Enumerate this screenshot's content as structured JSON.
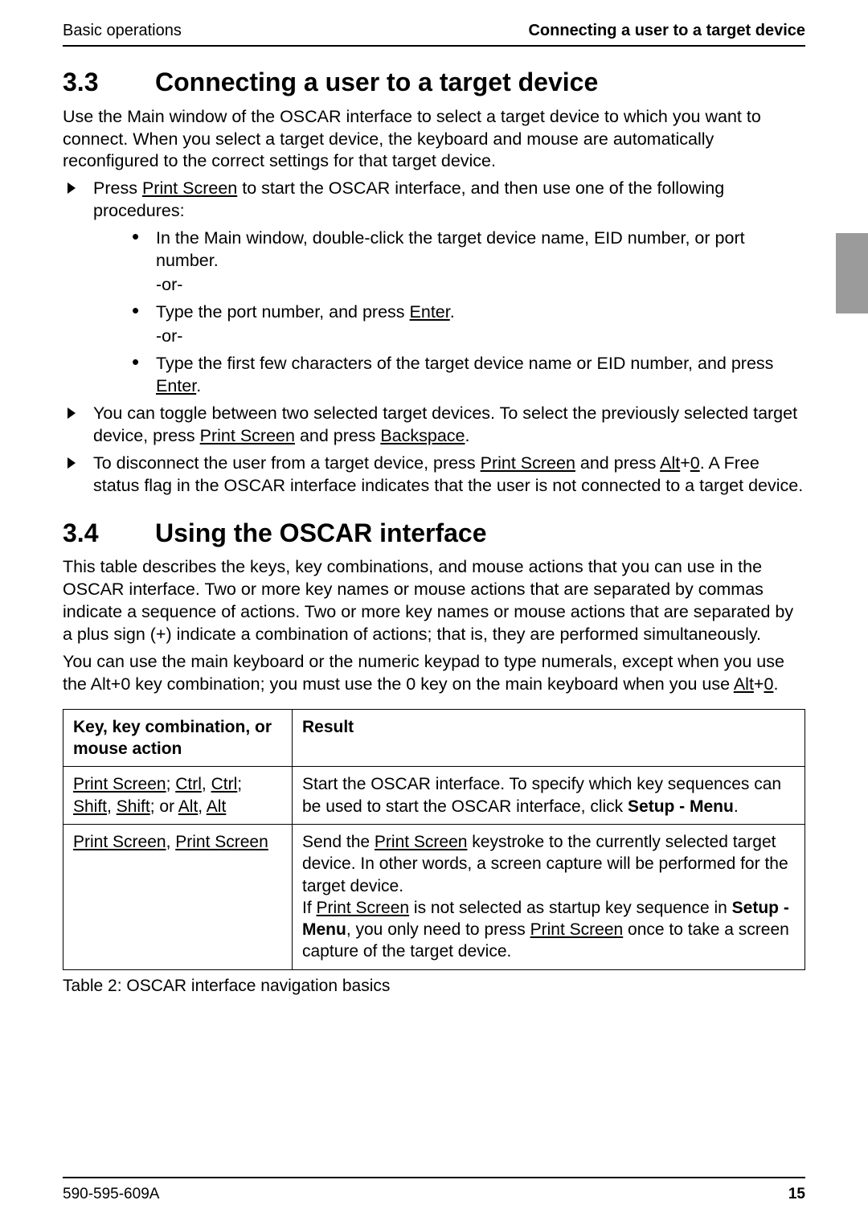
{
  "header": {
    "left": "Basic operations",
    "right": "Connecting a user to a target device"
  },
  "section33": {
    "number": "3.3",
    "title": "Connecting a user to a target device",
    "intro": "Use the Main window of the OSCAR interface to select a target device to which you want to connect. When you select a target device, the keyboard and mouse are automatically reconfigured to the correct settings for that target device.",
    "b1_pre": "Press ",
    "b1_u1": "Print Screen",
    "b1_post": " to start the OSCAR interface, and then use one of the following procedures:",
    "d1": "In the Main window, double-click the target device name, EID number, or port number.",
    "or": "-or-",
    "d2_pre": "Type the port number, and press ",
    "d2_u": "Enter",
    "d2_post": ".",
    "d3_pre": "Type the first few characters of the target device name or EID number, and press ",
    "d3_u": "Enter",
    "d3_post": ".",
    "b2_pre": "You can toggle between two selected target devices. To select the previously selected target device, press ",
    "b2_u1": "Print Screen",
    "b2_mid": " and press ",
    "b2_u2": "Backspace",
    "b2_post": ".",
    "b3_pre": "To disconnect the user from a target device, press ",
    "b3_u1": "Print Screen",
    "b3_mid1": " and press ",
    "b3_u2": "Alt",
    "b3_plus": "+",
    "b3_u3": "0",
    "b3_post": ". A Free status flag in the OSCAR interface indicates that the user is not connected to a target device."
  },
  "section34": {
    "number": "3.4",
    "title": "Using the OSCAR interface",
    "p1": "This table describes the keys, key combinations, and mouse actions that you can use in the OSCAR interface. Two or more key names or mouse actions that are separated by commas indicate a sequence of actions. Two or more key names or mouse actions that are separated by a plus sign (+) indicate a combination of actions; that is, they are performed simultaneously.",
    "p2_pre": "You can use the main keyboard or the numeric keypad to type numerals, except when you use the Alt+0 key combination; you must use the 0 key on the main keyboard when you use ",
    "p2_u1": "Alt",
    "p2_plus": "+",
    "p2_u2": "0",
    "p2_post": "."
  },
  "table": {
    "head_col1": "Key, key combination, or mouse action",
    "head_col2": "Result",
    "r1c1_u1": "Print Screen",
    "r1c1_s1": "; ",
    "r1c1_u2": "Ctrl",
    "r1c1_s2": ", ",
    "r1c1_u3": "Ctrl",
    "r1c1_s3": "; ",
    "r1c1_u4": "Shift",
    "r1c1_s4": ", ",
    "r1c1_u5": "Shift",
    "r1c1_s5": "; or ",
    "r1c1_u6": "Alt",
    "r1c1_s6": ", ",
    "r1c1_u7": "Alt",
    "r1c2_pre": "Start the OSCAR interface. To specify which key sequences can be used to start the OSCAR interface, click ",
    "r1c2_b": "Setup - Menu",
    "r1c2_post": ".",
    "r2c1_u1": "Print Screen",
    "r2c1_s1": ", ",
    "r2c1_u2": "Print Screen",
    "r2c2_t1": "Send the ",
    "r2c2_u1": "Print Screen",
    "r2c2_t2": " keystroke to the currently selected target device. In other words, a screen capture will be performed for the target device.",
    "r2c2_t3": "If ",
    "r2c2_u2": "Print Screen",
    "r2c2_t4": " is not selected as startup key sequence in ",
    "r2c2_b": "Setup - Menu",
    "r2c2_t5": ", you only need to press ",
    "r2c2_u3": "Print Screen",
    "r2c2_t6": " once to take a screen capture of the target device."
  },
  "caption": "Table 2: OSCAR interface navigation basics",
  "footer": {
    "left": "590-595-609A",
    "right": "15"
  }
}
